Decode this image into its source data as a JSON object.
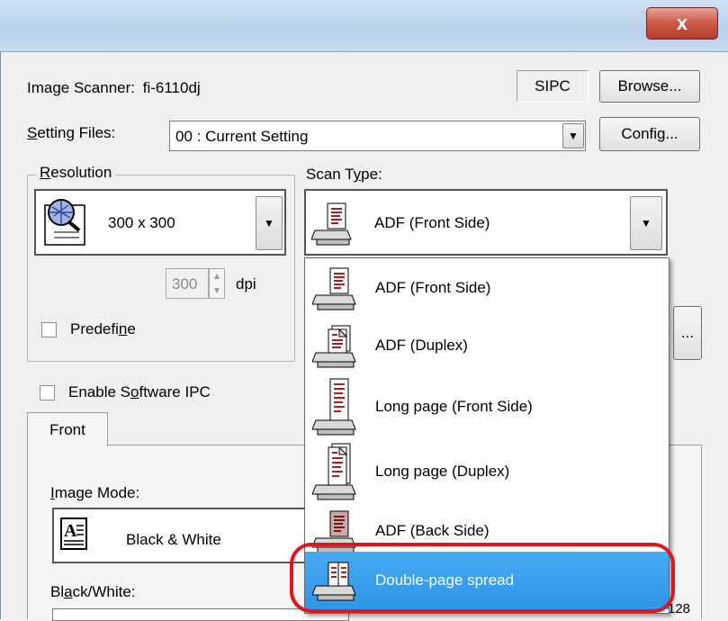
{
  "window": {
    "close_label": "x"
  },
  "scanner": {
    "label": "Image Scanner:",
    "model": "fi-6110dj",
    "sipc_label": "SIPC",
    "browse_label": "Browse..."
  },
  "setting_files": {
    "label": "Setting Files:",
    "value": "00 : Current Setting",
    "config_label": "Config..."
  },
  "resolution": {
    "group_label": "Resolution",
    "value": "300 x 300",
    "dpi_value": "300",
    "dpi_unit": "dpi",
    "predefine_label": "Predefine"
  },
  "scan_type": {
    "label": "Scan Type:",
    "selected": "ADF (Front Side)",
    "options": [
      "ADF (Front Side)",
      "ADF (Duplex)",
      "Long page (Front Side)",
      "Long page (Duplex)",
      "ADF (Back Side)",
      "Double-page spread"
    ],
    "highlighted": "Double-page spread"
  },
  "more_button_label": "...",
  "software_ipc": {
    "label": "Enable Software IPC"
  },
  "tabs": [
    {
      "label": "Front"
    }
  ],
  "image_mode": {
    "label": "Image Mode:",
    "value": "Black & White"
  },
  "black_white": {
    "label": "Black/White:"
  },
  "partial_text": "128"
}
